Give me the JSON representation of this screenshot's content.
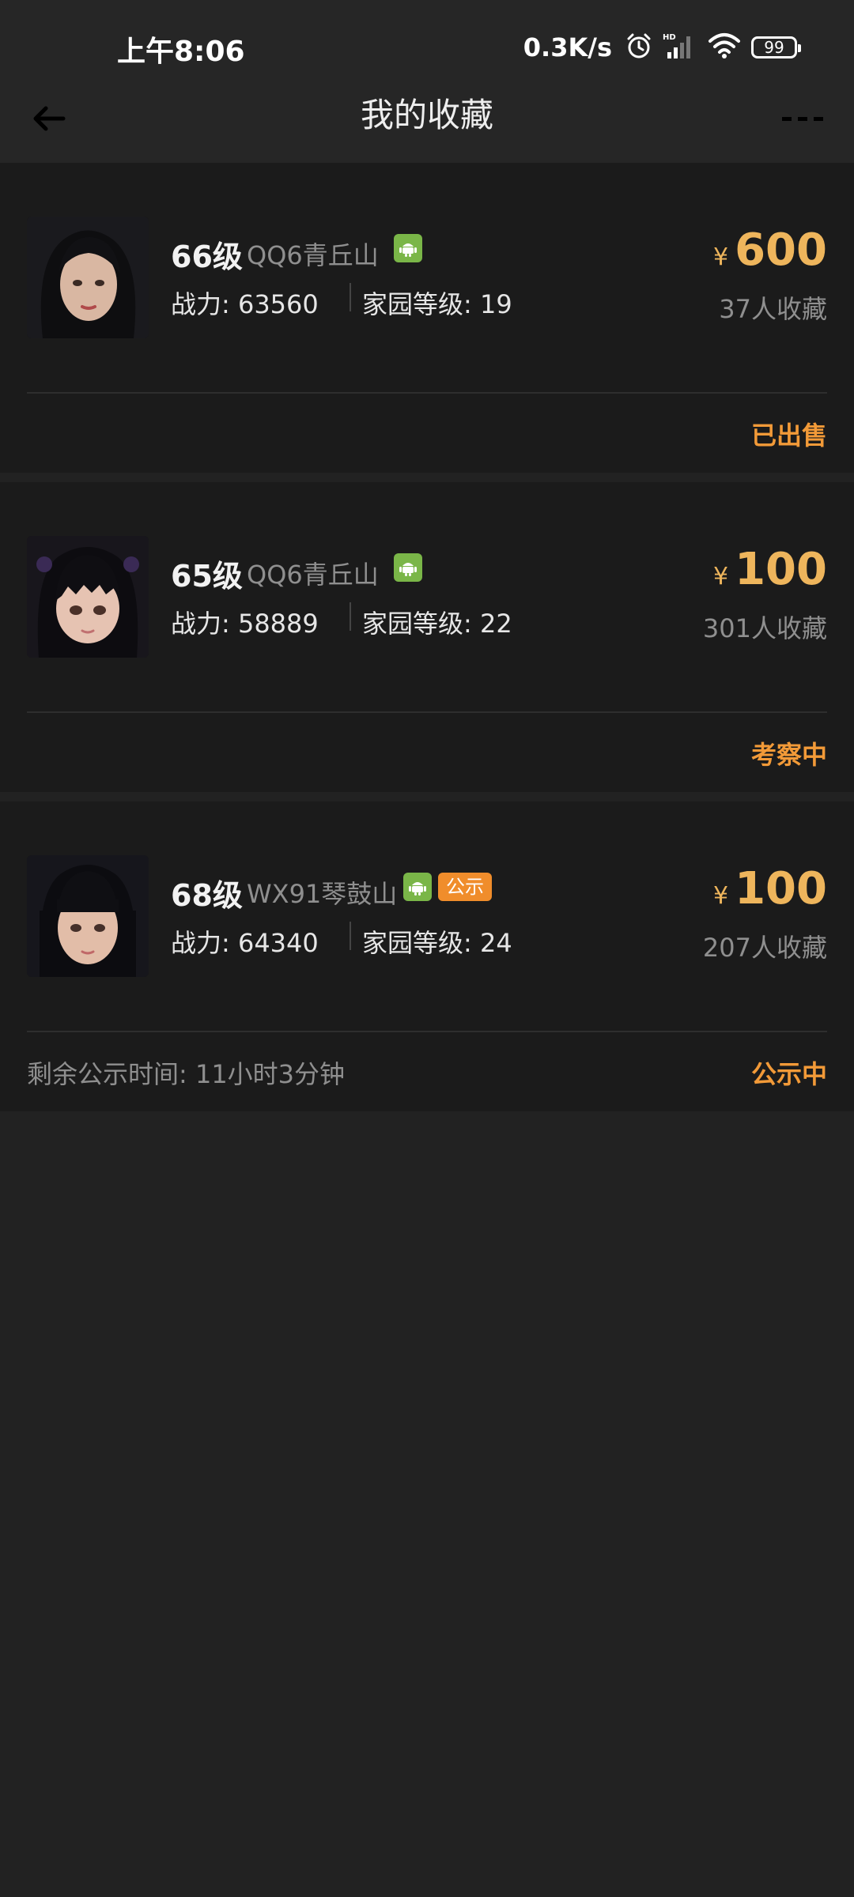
{
  "status_bar": {
    "time": "上午8:06",
    "net_speed": "0.3K/s",
    "battery": "99"
  },
  "header": {
    "title": "我的收藏"
  },
  "items": [
    {
      "level": "66级",
      "server": "QQ6青丘山",
      "power": "战力: 63560",
      "home_level": "家园等级: 19",
      "price_symbol": "¥",
      "price": "600",
      "fav_count": "37人收藏",
      "status": "已出售"
    },
    {
      "level": "65级",
      "server": "QQ6青丘山",
      "power": "战力: 58889",
      "home_level": "家园等级: 22",
      "price_symbol": "¥",
      "price": "100",
      "fav_count": "301人收藏",
      "status": "考察中"
    },
    {
      "level": "68级",
      "server": "WX91琴鼓山",
      "badge": "公示",
      "power": "战力: 64340",
      "home_level": "家园等级: 24",
      "price_symbol": "¥",
      "price": "100",
      "fav_count": "207人收藏",
      "remaining": "剩余公示时间: 11小时3分钟",
      "status": "公示中"
    }
  ],
  "colors": {
    "background": "#222222",
    "card": "#1b1b1b",
    "price": "#eeb55c",
    "status": "#f29a38",
    "android": "#7ab648",
    "public_badge": "#f08d2b"
  }
}
